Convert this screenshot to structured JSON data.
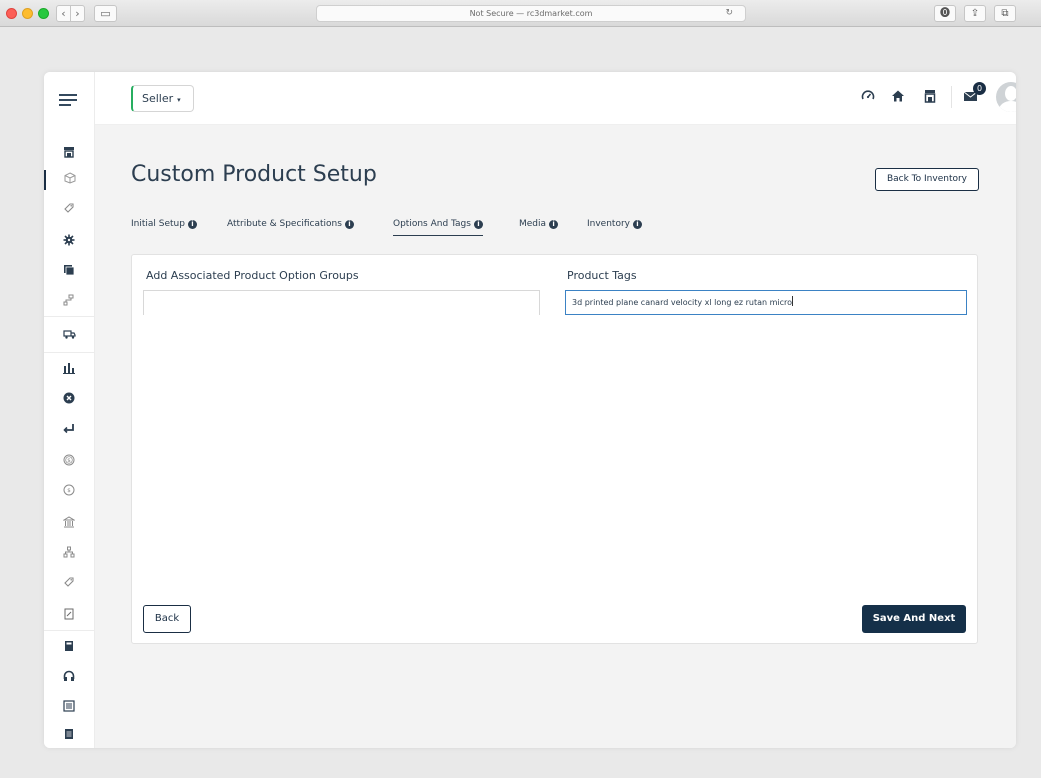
{
  "browser": {
    "url_text": "Not Secure — rc3dmarket.com",
    "nav_back": "‹",
    "nav_forward": "›",
    "sidebar_toggle": "▭",
    "reload": "↻",
    "buttons": [
      "⓿",
      "⇪",
      "⧉"
    ]
  },
  "header": {
    "seller_label": "Seller",
    "seller_caret": "▾",
    "notification_count": "0",
    "icons": [
      "dashboard-icon",
      "home-icon",
      "store-icon",
      "message-icon"
    ]
  },
  "sidebar": {
    "icons": [
      "store-icon",
      "product-box-icon",
      "tag-icon",
      "settings-gear-icon",
      "copy-icon",
      "hierarchy-icon",
      "shipping-icon",
      "bar-chart-icon",
      "cancel-circle-icon",
      "return-arrow-icon",
      "coin-icon",
      "coin-outline-icon",
      "bank-icon",
      "network-icon",
      "label-icon",
      "document-icon",
      "calculator-icon",
      "headset-icon",
      "list-icon",
      "report-icon"
    ]
  },
  "page": {
    "title": "Custom Product Setup",
    "back_to_inventory": "Back To Inventory",
    "tabs": [
      {
        "label": "Initial Setup",
        "info": "i"
      },
      {
        "label": "Attribute & Specifications",
        "info": "i"
      },
      {
        "label": "Options And Tags",
        "info": "i"
      },
      {
        "label": "Media",
        "info": "i"
      },
      {
        "label": "Inventory",
        "info": "i"
      }
    ],
    "active_tab": "Options And Tags"
  },
  "form": {
    "option_groups_label": "Add Associated Product Option Groups",
    "option_groups_value": "",
    "product_tags_label": "Product Tags",
    "product_tags_value": "3d printed plane canard velocity xl long ez rutan micro"
  },
  "actions": {
    "back": "Back",
    "save_next": "Save And Next"
  },
  "colors": {
    "primary": "#153049",
    "accent_green": "#27ae60",
    "focus_blue": "#3b82c4",
    "background": "#f3f3f3"
  }
}
